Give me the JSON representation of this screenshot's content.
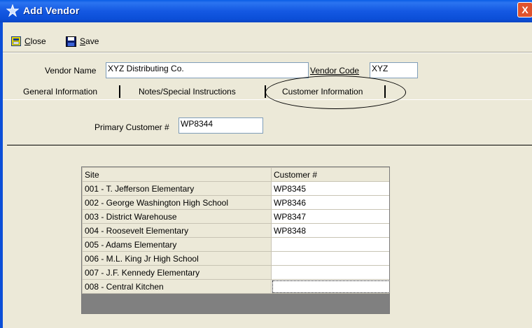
{
  "window": {
    "title": "Add Vendor",
    "close_glyph": "X"
  },
  "toolbar": {
    "close": {
      "accel": "C",
      "rest": "lose",
      "icon": "close-doc-icon"
    },
    "save": {
      "accel": "S",
      "rest": "ave",
      "icon": "floppy-disk-icon"
    }
  },
  "vendor": {
    "name_label": "Vendor Name",
    "name_value": "XYZ Distributing Co.",
    "code_label": "Vendor Code",
    "code_value": "XYZ"
  },
  "tabs": [
    {
      "label": "General Information"
    },
    {
      "label": "Notes/Special Instructions"
    },
    {
      "label": "Customer Information"
    }
  ],
  "primary_customer": {
    "label": "Primary Customer #",
    "value": "WP8344"
  },
  "grid": {
    "columns": [
      "Site",
      "Customer #"
    ],
    "rows": [
      {
        "site": "001 - T. Jefferson Elementary",
        "customer": "WP8345"
      },
      {
        "site": "002 - George Washington High School",
        "customer": "WP8346"
      },
      {
        "site": "003 - District Warehouse",
        "customer": "WP8347"
      },
      {
        "site": "004 - Roosevelt Elementary",
        "customer": "WP8348"
      },
      {
        "site": "005 - Adams Elementary",
        "customer": ""
      },
      {
        "site": "006 - M.L. King Jr High School",
        "customer": ""
      },
      {
        "site": "007 - J.F. Kennedy Elementary",
        "customer": ""
      },
      {
        "site": "008 - Central Kitchen",
        "customer": ""
      }
    ]
  }
}
